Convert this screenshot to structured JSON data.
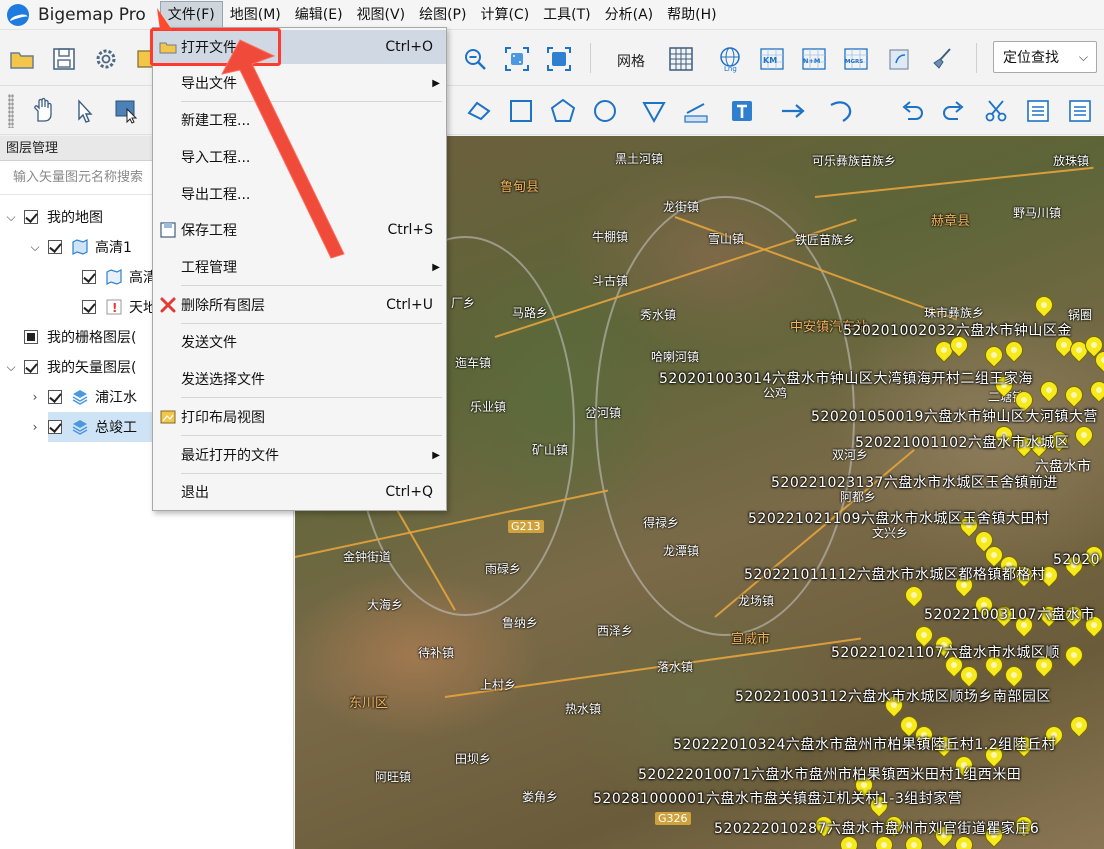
{
  "app": {
    "title": "Bigemap Pro"
  },
  "menubar": {
    "items": [
      {
        "label": "文件(F)"
      },
      {
        "label": "地图(M)"
      },
      {
        "label": "编辑(E)"
      },
      {
        "label": "视图(V)"
      },
      {
        "label": "绘图(P)"
      },
      {
        "label": "计算(C)"
      },
      {
        "label": "工具(T)"
      },
      {
        "label": "分析(A)"
      },
      {
        "label": "帮助(H)"
      }
    ]
  },
  "toolbar": {
    "grid_label": "网格",
    "locate_label": "定位查找",
    "btn_lng": "Lng",
    "btn_km": "KM",
    "btn_nm": "N+M",
    "btn_mgrs": "MGRS"
  },
  "file_menu": {
    "items": [
      {
        "label": "打开文件...",
        "shortcut": "Ctrl+O"
      },
      {
        "label": "导出文件",
        "shortcut": ""
      },
      {
        "label": "新建工程...",
        "shortcut": ""
      },
      {
        "label": "导入工程...",
        "shortcut": ""
      },
      {
        "label": "导出工程...",
        "shortcut": ""
      },
      {
        "label": "保存工程",
        "shortcut": "Ctrl+S"
      },
      {
        "label": "工程管理",
        "shortcut": ""
      },
      {
        "label": "删除所有图层",
        "shortcut": "Ctrl+U"
      },
      {
        "label": "发送文件",
        "shortcut": ""
      },
      {
        "label": "发送选择文件",
        "shortcut": ""
      },
      {
        "label": "打印布局视图",
        "shortcut": ""
      },
      {
        "label": "最近打开的文件",
        "shortcut": ""
      },
      {
        "label": "退出",
        "shortcut": "Ctrl+Q"
      }
    ]
  },
  "layer_panel": {
    "header": "图层管理",
    "search_placeholder": "输入矢量图元名称搜索",
    "tree": [
      {
        "label": "我的地图"
      },
      {
        "label": "高清1"
      },
      {
        "label": "高清"
      },
      {
        "label": "天地"
      },
      {
        "label": "我的栅格图层("
      },
      {
        "label": "我的矢量图层("
      },
      {
        "label": "浦江水"
      },
      {
        "label": "总竣工"
      }
    ]
  },
  "map": {
    "places": [
      "黑土河镇",
      "可乐彝族苗族乡",
      "放珠镇",
      "鲁甸县",
      "龙街镇",
      "野马川镇",
      "赫章县",
      "牛棚镇",
      "雪山镇",
      "铁匠苗族乡",
      "斗古镇",
      "马路乡",
      "秀水镇",
      "珠市彝族乡",
      "锅圈",
      "厂乡",
      "迤车镇",
      "哈喇河镇",
      "乐业镇",
      "岔河镇",
      "公鸡",
      "矿山镇",
      "双河乡",
      "阿都乡",
      "文兴乡",
      "得禄乡",
      "龙潭镇",
      "金钟街道",
      "雨碌乡",
      "大海乡",
      "龙场镇",
      "鲁纳乡",
      "西泽乡",
      "宣威市",
      "待补镇",
      "落水镇",
      "上村乡",
      "东川区",
      "热水镇",
      "阿旺镇",
      "田坝乡",
      "娄角乡",
      "六盘水市",
      "二塘镇",
      "中安镇汽车站"
    ],
    "poi_labels": [
      "520201002032六盘水市钟山区金",
      "520201003014六盘水市钟山区大湾镇海开村二组王家海",
      "520201050019六盘水市钟山区大河镇大营",
      "520221001102六盘水市水城区",
      "520221023137六盘水市水城区玉舍镇前进",
      "520221021109六盘水市水城区玉舍镇大田村",
      "520221011112六盘水市水城区都格镇都格村",
      "520221003107六盘水市",
      "520221021107六盘水市水城区顺",
      "520221003112六盘水市水城区顺场乡南部园区",
      "520222010324六盘水市盘州市柏果镇陸丘村1.2组陸丘村",
      "520222010071六盘水市盘州市柏果镇西米田村1组西米田",
      "520281000001六盘水市盘关镇盘江机关村1-3组封家营",
      "520222010287六盘水市盘州市刘官街道瞿家庄6",
      "52020"
    ],
    "road_labels": [
      "G213",
      "G326"
    ]
  },
  "colors": {
    "highlight": "#ff3b2f",
    "marker": "#f6ea1c",
    "menu_hover": "#cfd8e3",
    "app_blue": "#1e7be0"
  }
}
